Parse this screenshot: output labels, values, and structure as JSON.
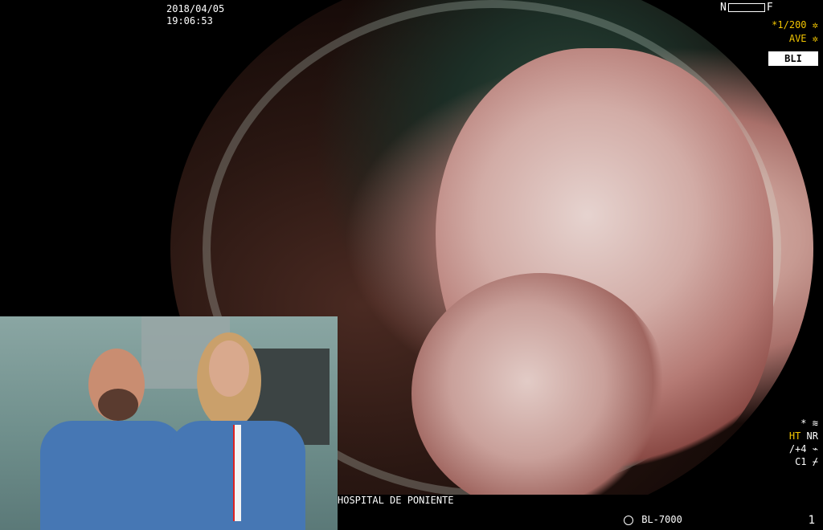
{
  "overlay": {
    "date": "2018/04/05",
    "time": "19:06:53",
    "slider_left": "N",
    "slider_right": "F",
    "shutter": "*1/200",
    "ave": "AVE",
    "mode_badge": "BLI",
    "right_stack": {
      "line1": "*",
      "line2_ht": "HT",
      "line2_nr": "NR",
      "line3": "/+4",
      "line4": "C1"
    },
    "hospital": "HOSPITAL DE PONIENTE",
    "device": "BL-7000",
    "page_number": "1"
  },
  "colors": {
    "accent_yellow": "#f2c500",
    "scrub_blue": "#4677b4"
  },
  "icons": {
    "shutter_icon": "gear-icon",
    "ave_icon": "gear-icon",
    "light_icon": "sun-icon"
  }
}
